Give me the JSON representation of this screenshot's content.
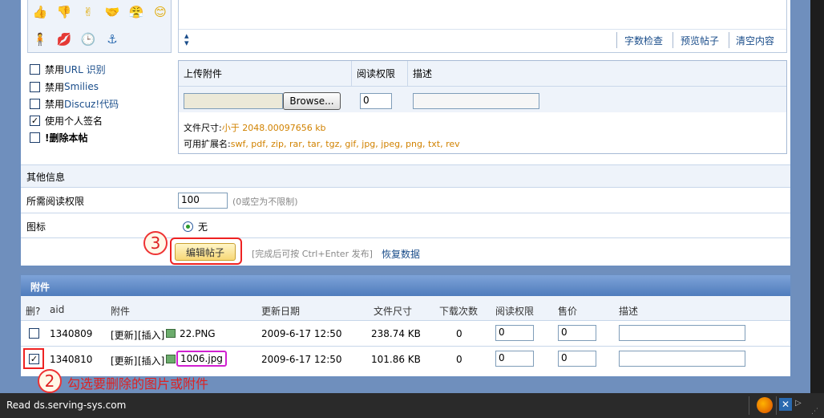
{
  "editor": {
    "toolbar": {
      "char_check": "字数检查",
      "preview": "预览帖子",
      "clear": "清空内容"
    },
    "emoticons": [
      "👍",
      "👎",
      "✌",
      "🤝",
      "😤",
      "😊",
      "🧍",
      "💋",
      "🕒",
      "⚓"
    ]
  },
  "options": {
    "disable_url": {
      "prefix": "禁用 ",
      "blue": "URL 识别",
      "checked": false
    },
    "disable_smilies": {
      "prefix": "禁用 ",
      "blue": "Smilies",
      "checked": false
    },
    "disable_discuz": {
      "prefix": "禁用 ",
      "blue": "Discuz!代码",
      "checked": false
    },
    "use_signature": {
      "prefix": "使用个人签名",
      "blue": "",
      "checked": true
    },
    "delete_post": {
      "label": "!删除本帖",
      "checked": false
    }
  },
  "upload": {
    "headers": {
      "upload": "上传附件",
      "perm": "阅读权限",
      "desc": "描述"
    },
    "browse_label": "Browse...",
    "perm_value": "0",
    "size_label": "文件尺寸:",
    "size_value": "小于 2048.00097656 kb",
    "ext_label": "可用扩展名:",
    "ext_value": "swf, pdf, zip, rar, tar, tgz, gif, jpg, jpeg, png, txt, rev"
  },
  "other": {
    "title": "其他信息",
    "perm_label": "所需阅读权限",
    "perm_value": "100",
    "perm_hint": "(0或空为不限制)",
    "icon_label": "图标",
    "icon_none": "无",
    "submit": "编辑帖子",
    "submit_hint": "[完成后可按 Ctrl+Enter 发布]",
    "restore": "恢复数据"
  },
  "attachments": {
    "title": "附件",
    "columns": {
      "del": "删?",
      "aid": "aid",
      "name": "附件",
      "date": "更新日期",
      "size": "文件尺寸",
      "downloads": "下载次数",
      "perm": "阅读权限",
      "price": "售价",
      "desc": "描述"
    },
    "update_label": "[更新]",
    "insert_label": "[插入]",
    "rows": [
      {
        "aid": "1340809",
        "file": "22.PNG",
        "date": "2009-6-17 12:50",
        "size": "238.74 KB",
        "downloads": "0",
        "perm": "0",
        "price": "0",
        "checked": false
      },
      {
        "aid": "1340810",
        "file": "1006.jpg",
        "date": "2009-6-17 12:50",
        "size": "101.86 KB",
        "downloads": "0",
        "perm": "0",
        "price": "0",
        "checked": true
      }
    ]
  },
  "annotations": {
    "n2": "2",
    "n3": "3",
    "hint2": "勾选要删除的图片或附件"
  },
  "statusbar": {
    "text": "Read ds.serving-sys.com"
  }
}
